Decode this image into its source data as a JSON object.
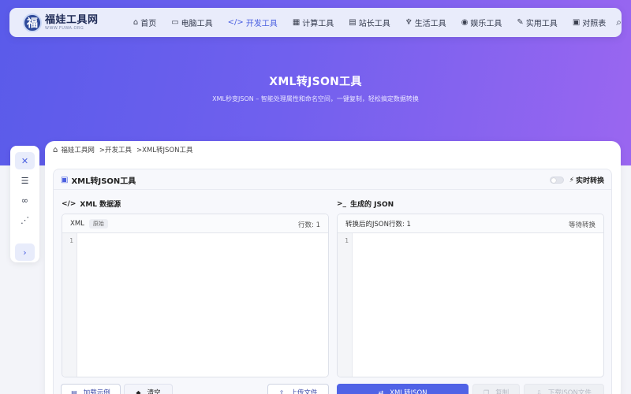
{
  "navbar": {
    "logo_mark": "福",
    "logo_title": "福娃工具网",
    "logo_sub": "WWW.FUWA.ORG",
    "items": [
      {
        "icon": "⌂",
        "label": "首页"
      },
      {
        "icon": "▭",
        "label": "电脑工具"
      },
      {
        "icon": "</>",
        "label": "开发工具",
        "active": true
      },
      {
        "icon": "▦",
        "label": "计算工具"
      },
      {
        "icon": "▤",
        "label": "站长工具"
      },
      {
        "icon": "♆",
        "label": "生活工具"
      },
      {
        "icon": "◉",
        "label": "娱乐工具"
      },
      {
        "icon": "✎",
        "label": "实用工具"
      },
      {
        "icon": "▣",
        "label": "对照表"
      }
    ],
    "search_icon": "⌕"
  },
  "hero": {
    "title": "XML转JSON工具",
    "subtitle": "XML秒变JSON – 智能处理属性和命名空间，一键复制，轻松搞定数据转换"
  },
  "sidebar": {
    "buttons": [
      {
        "icon": "✕",
        "name": "tools"
      },
      {
        "icon": "☰",
        "name": "list"
      },
      {
        "icon": "∞",
        "name": "link"
      },
      {
        "icon": "⋰",
        "name": "share"
      },
      {
        "icon": "›",
        "name": "expand"
      }
    ]
  },
  "breadcrumb": {
    "home": "福娃工具网",
    "level1": ">开发工具",
    "level2": ">XML转JSON工具"
  },
  "tool": {
    "title": "XML转JSON工具",
    "realtime_label": "实时转换",
    "realtime_on": false
  },
  "input_panel": {
    "section_title": "XML 数据源",
    "header_label": "XML",
    "tag": "原始",
    "line_count": "行数: 1",
    "line_numbers": "1"
  },
  "output_panel": {
    "section_title": "生成的 JSON",
    "header_label": "转换后的JSON行数: 1",
    "status": "等待转换",
    "line_numbers": "1"
  },
  "buttons": {
    "load_example": "加载示例",
    "clear": "清空",
    "upload": "上传文件",
    "convert": "XML转JSON",
    "copy": "复制",
    "download": "下载JSON文件"
  },
  "colors": {
    "accent": "#5063e6",
    "hero_start": "#5a5bea",
    "hero_end": "#9a66f0"
  }
}
